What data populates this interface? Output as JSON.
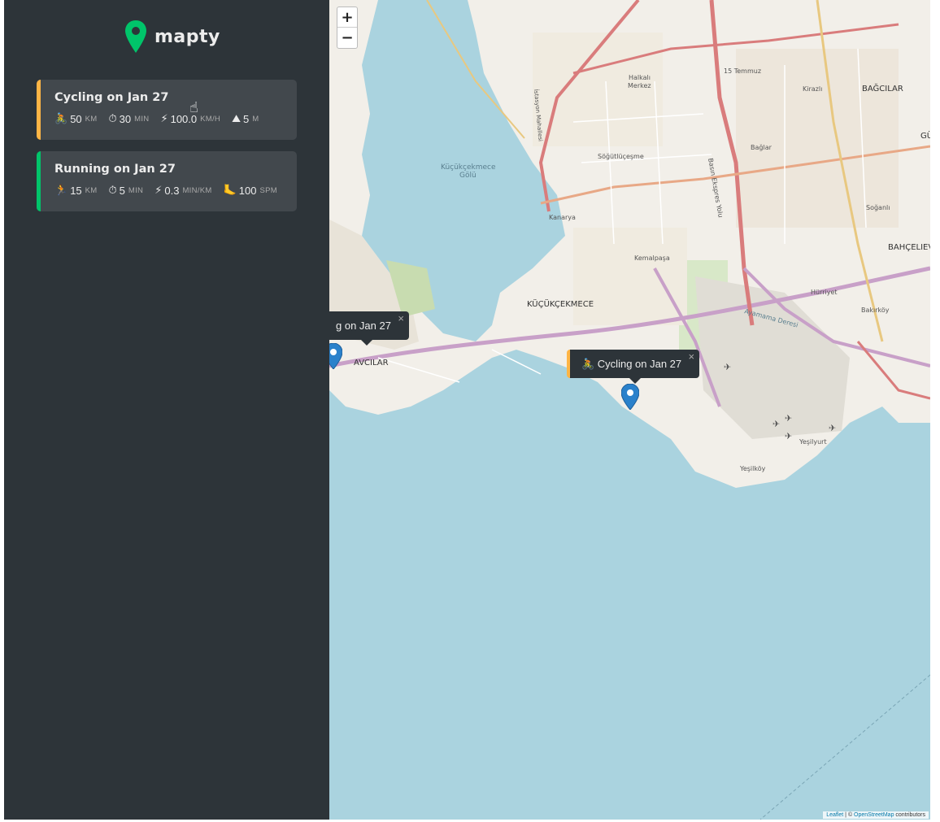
{
  "brand": {
    "name": "mapty",
    "accent": "#00c46a"
  },
  "workouts": [
    {
      "title": "Cycling on Jan 27",
      "type": "cycling",
      "accent": "#ffb545",
      "distance": {
        "icon": "🚴",
        "value": "50",
        "unit": "KM"
      },
      "duration": {
        "icon": "⏱",
        "value": "30",
        "unit": "MIN"
      },
      "speed": {
        "icon": "⚡",
        "value": "100.0",
        "unit": "KM/H"
      },
      "extra": {
        "icon": "⛰",
        "value": "5",
        "unit": "M"
      }
    },
    {
      "title": "Running on Jan 27",
      "type": "running",
      "accent": "#00c46a",
      "distance": {
        "icon": "🏃",
        "value": "15",
        "unit": "KM"
      },
      "duration": {
        "icon": "⏱",
        "value": "5",
        "unit": "MIN"
      },
      "speed": {
        "icon": "⚡",
        "value": "0.3",
        "unit": "MIN/KM"
      },
      "extra": {
        "icon": "🦶",
        "value": "100",
        "unit": "SPM"
      }
    }
  ],
  "map": {
    "zoom_in": "+",
    "zoom_out": "−",
    "popups": [
      {
        "text": "g on Jan 27",
        "close": "×"
      },
      {
        "text": "🚴 Cycling on Jan 27",
        "close": "×"
      }
    ],
    "labels": {
      "kucukcekmece": "KÜÇÜKÇEKMECE",
      "avcilar": "AVCILAR",
      "bagcilar": "BAĞCILAR",
      "bahcelievler": "BAHÇELIEV",
      "lake": "Küçükçekmece",
      "lake2": "Gölü",
      "halkali": "Halkalı",
      "merkez": "Merkez",
      "sogutlucesme": "Söğütlüçeşme",
      "bagcilar_small": "Bağlar",
      "kemalpasa": "Kemalpaşa",
      "yesilkoy": "Yeşilköy",
      "yesilyurt": "Yeşilyurt",
      "temmuz": "15 Temmuz",
      "kirazli": "Kirazlı",
      "soganli": "Soğanlı",
      "hurriyet": "Hürriyet",
      "bakirkoy": "Bakırköy",
      "kanarya": "Kanarya",
      "ayamama": "Ayamama Deresi",
      "basin": "Basın Ekspres Yolu",
      "gu": "GÜ",
      "istasyon": "İstasyon Mahallesi"
    },
    "attribution": {
      "leaflet": "Leaflet",
      "sep": " | © ",
      "osm": "OpenStreetMap",
      "rest": " contributors"
    }
  }
}
